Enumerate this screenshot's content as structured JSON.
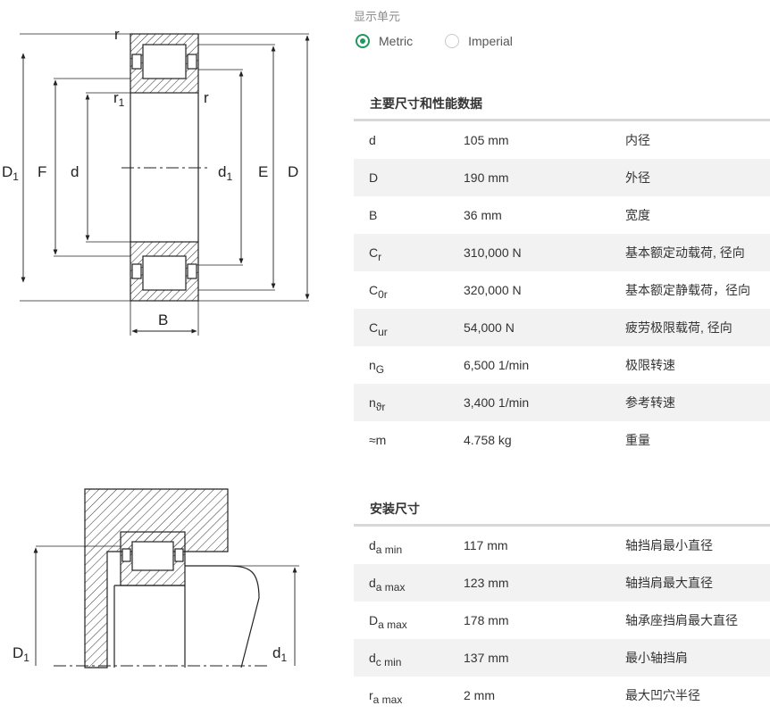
{
  "drawing_labels": {
    "r_top": "r",
    "r1": "r",
    "r1_sub": "1",
    "r_right": "r",
    "D1": "D",
    "D1_sub": "1",
    "F": "F",
    "d": "d",
    "d1": "d",
    "d1_sub": "1",
    "E": "E",
    "D": "D",
    "B": "B",
    "mount_D1": "D",
    "mount_D1_sub": "1",
    "mount_d1": "d",
    "mount_d1_sub": "1"
  },
  "units": {
    "title": "显示单元",
    "options": [
      {
        "label": "Metric",
        "selected": true
      },
      {
        "label": "Imperial",
        "selected": false
      }
    ]
  },
  "main_dims": {
    "title": "主要尺寸和性能数据",
    "rows": [
      {
        "sym": "d",
        "sub": "",
        "value": "105 mm",
        "desc": "内径"
      },
      {
        "sym": "D",
        "sub": "",
        "value": "190 mm",
        "desc": "外径"
      },
      {
        "sym": "B",
        "sub": "",
        "value": "36 mm",
        "desc": "宽度"
      },
      {
        "sym": "C",
        "sub": "r",
        "value": "310,000 N",
        "desc": "基本额定动载荷, 径向"
      },
      {
        "sym": "C",
        "sub": "0r",
        "value": "320,000 N",
        "desc": "基本额定静载荷，径向"
      },
      {
        "sym": "C",
        "sub": "ur",
        "value": "54,000 N",
        "desc": "疲劳极限载荷, 径向"
      },
      {
        "sym": "n",
        "sub": "G",
        "value": "6,500 1/min",
        "desc": "极限转速"
      },
      {
        "sym": "n",
        "sub": "ϑr",
        "value": "3,400 1/min",
        "desc": "参考转速"
      },
      {
        "sym": "≈m",
        "sub": "",
        "value": "4.758 kg",
        "desc": "重量"
      }
    ]
  },
  "mount_dims": {
    "title": "安装尺寸",
    "rows": [
      {
        "sym": "d",
        "sub": "a min",
        "value": "117 mm",
        "desc": "轴挡肩最小直径"
      },
      {
        "sym": "d",
        "sub": "a max",
        "value": "123 mm",
        "desc": "轴挡肩最大直径"
      },
      {
        "sym": "D",
        "sub": "a max",
        "value": "178 mm",
        "desc": "轴承座挡肩最大直径"
      },
      {
        "sym": "d",
        "sub": "c min",
        "value": "137 mm",
        "desc": "最小轴挡肩"
      },
      {
        "sym": "r",
        "sub": "a max",
        "value": "2 mm",
        "desc": "最大凹穴半径"
      }
    ]
  }
}
